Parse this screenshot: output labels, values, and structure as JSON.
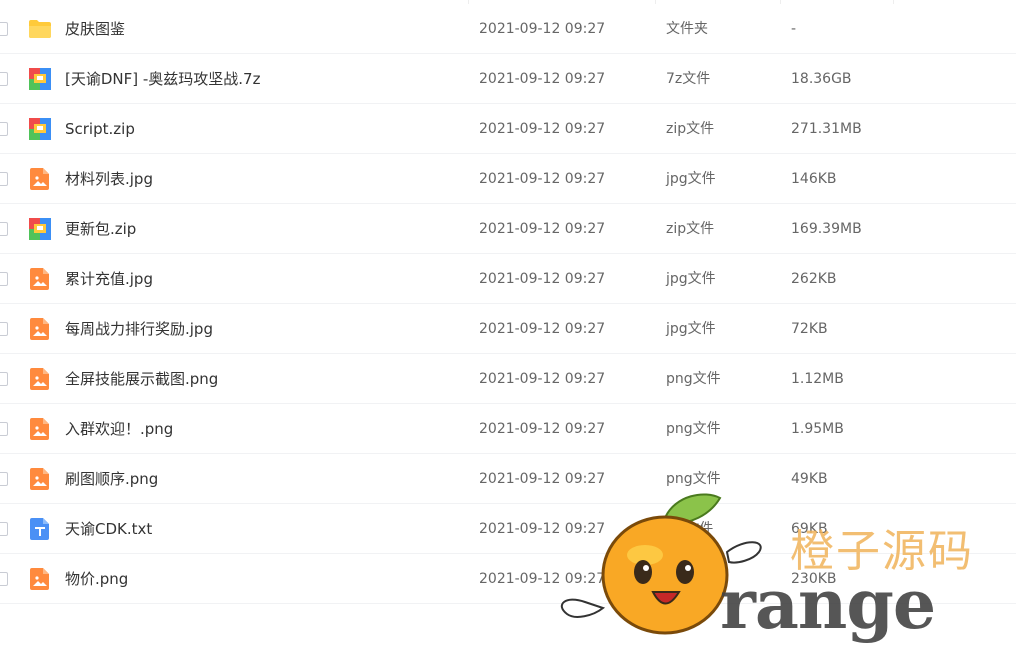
{
  "files": [
    {
      "icon": "folder-icon",
      "name": "皮肤图鉴",
      "time": "2021-09-12 09:27",
      "type": "文件夹",
      "size": "-"
    },
    {
      "icon": "archive-icon",
      "name": "[天谕DNF] -奥兹玛攻坚战.7z",
      "time": "2021-09-12 09:27",
      "type": "7z文件",
      "size": "18.36GB"
    },
    {
      "icon": "archive-icon",
      "name": "Script.zip",
      "time": "2021-09-12 09:27",
      "type": "zip文件",
      "size": "271.31MB"
    },
    {
      "icon": "image-icon",
      "name": "材料列表.jpg",
      "time": "2021-09-12 09:27",
      "type": "jpg文件",
      "size": "146KB"
    },
    {
      "icon": "archive-icon",
      "name": "更新包.zip",
      "time": "2021-09-12 09:27",
      "type": "zip文件",
      "size": "169.39MB"
    },
    {
      "icon": "image-icon",
      "name": "累计充值.jpg",
      "time": "2021-09-12 09:27",
      "type": "jpg文件",
      "size": "262KB"
    },
    {
      "icon": "image-icon",
      "name": "每周战力排行奖励.jpg",
      "time": "2021-09-12 09:27",
      "type": "jpg文件",
      "size": "72KB"
    },
    {
      "icon": "image-icon",
      "name": "全屏技能展示截图.png",
      "time": "2021-09-12 09:27",
      "type": "png文件",
      "size": "1.12MB"
    },
    {
      "icon": "image-icon",
      "name": "入群欢迎！.png",
      "time": "2021-09-12 09:27",
      "type": "png文件",
      "size": "1.95MB"
    },
    {
      "icon": "image-icon",
      "name": "刷图顺序.png",
      "time": "2021-09-12 09:27",
      "type": "png文件",
      "size": "49KB"
    },
    {
      "icon": "text-file-icon",
      "name": "天谕CDK.txt",
      "time": "2021-09-12 09:27",
      "type": "txt文件",
      "size": "69KB"
    },
    {
      "icon": "image-icon",
      "name": "物价.png",
      "time": "2021-09-12 09:27",
      "type": "png文件",
      "size": "230KB"
    }
  ],
  "watermark": {
    "cn": "橙子源码",
    "en": "range"
  },
  "colors": {
    "folder": "#ffca3a",
    "image": "#ff8a3d",
    "text": "#4a90f5",
    "archive_red": "#f04b4b",
    "archive_blue": "#3b8ff5",
    "archive_green": "#4fc35a",
    "archive_yellow": "#ffc93b"
  }
}
